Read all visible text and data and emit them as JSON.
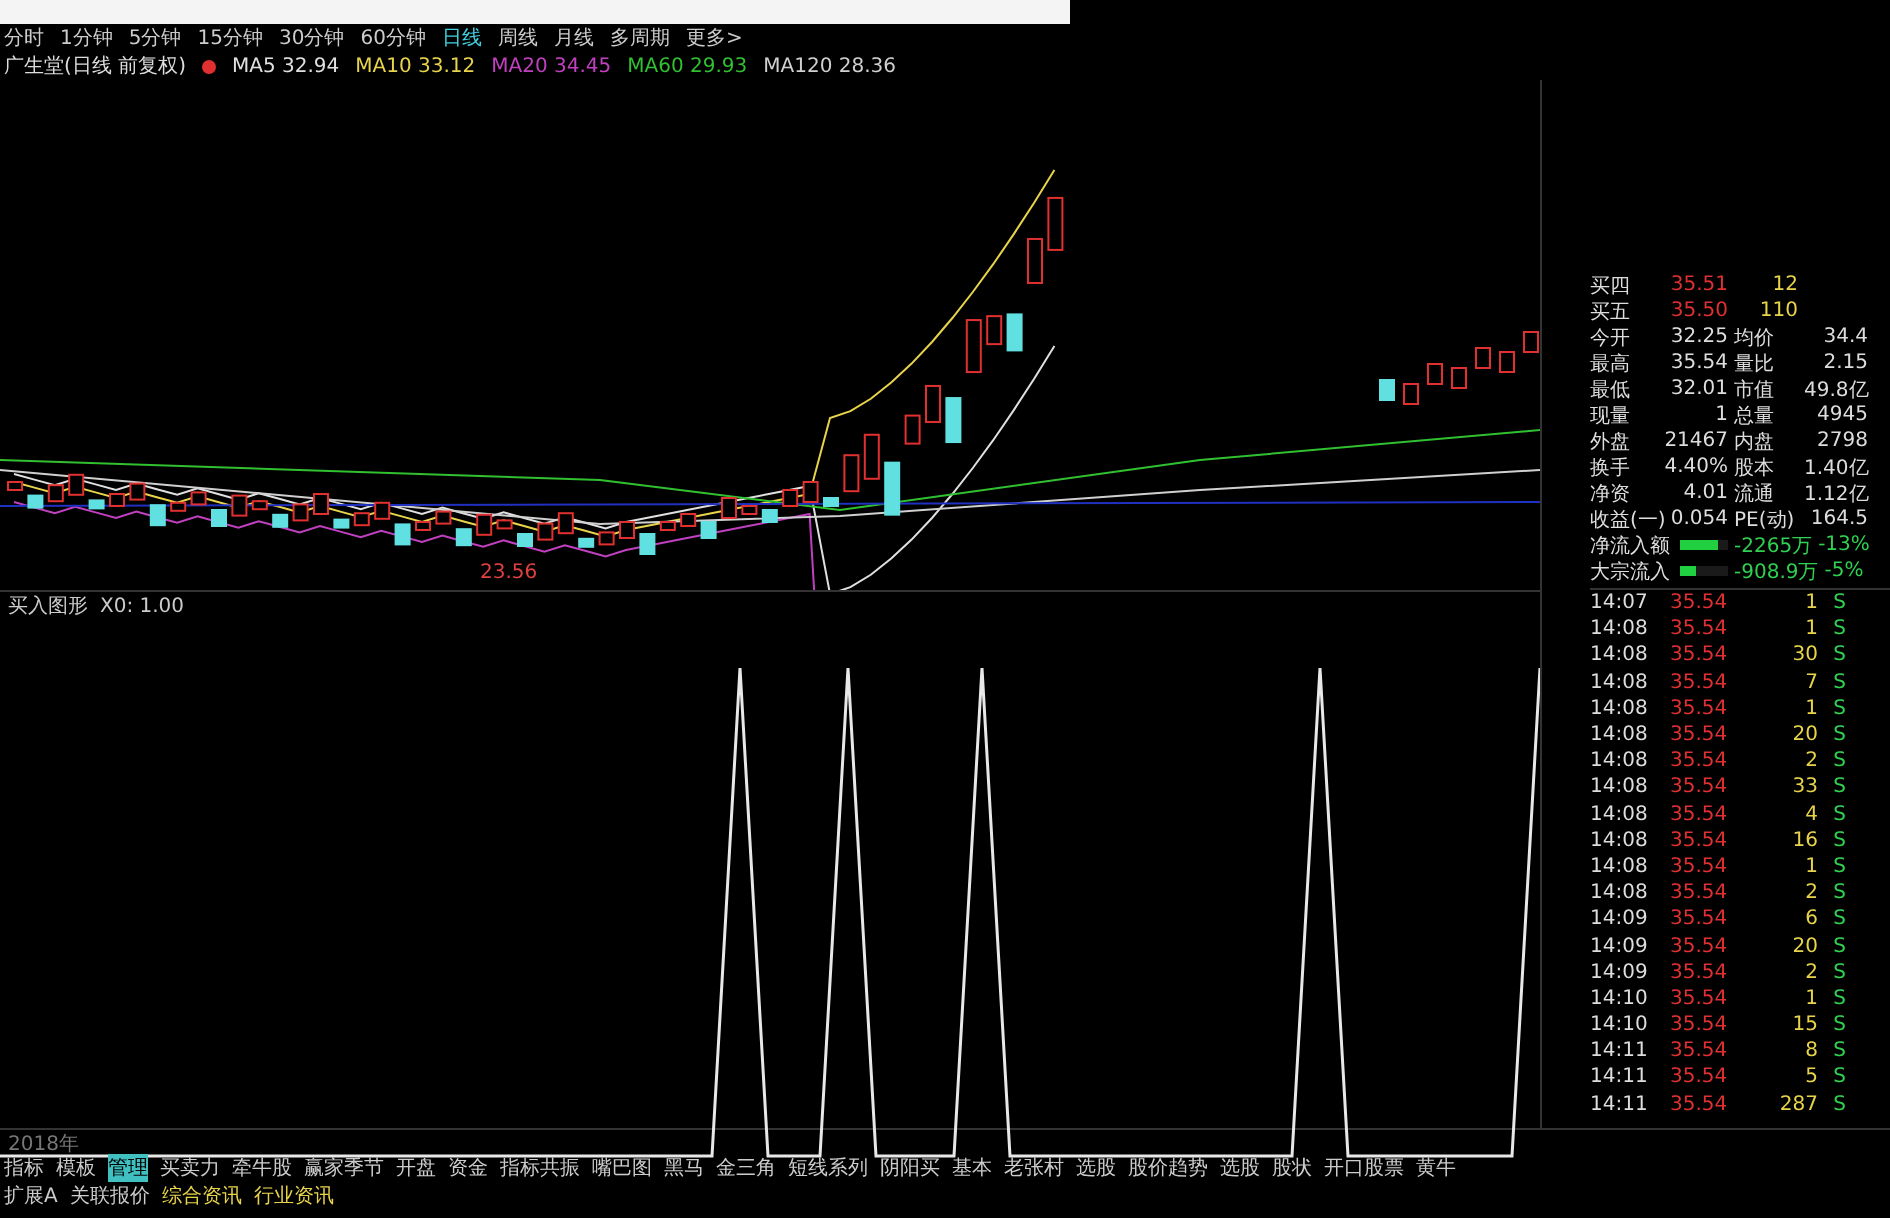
{
  "periods": [
    {
      "label": "分时",
      "selected": false
    },
    {
      "label": "1分钟",
      "selected": false
    },
    {
      "label": "5分钟",
      "selected": false
    },
    {
      "label": "15分钟",
      "selected": false
    },
    {
      "label": "30分钟",
      "selected": false
    },
    {
      "label": "60分钟",
      "selected": false
    },
    {
      "label": "日线",
      "selected": true
    },
    {
      "label": "周线",
      "selected": false
    },
    {
      "label": "月线",
      "selected": false
    },
    {
      "label": "多周期",
      "selected": false
    },
    {
      "label": "更多>",
      "selected": false
    }
  ],
  "legend": {
    "stock": "广生堂(日线 前复权)",
    "averages": [
      {
        "label": "MA5",
        "value": "32.94",
        "color": "#e0e0e0"
      },
      {
        "label": "MA10",
        "value": "33.12",
        "color": "#e8d44a"
      },
      {
        "label": "MA20",
        "value": "34.45",
        "color": "#c040c0"
      },
      {
        "label": "MA60",
        "value": "29.93",
        "color": "#30c030"
      },
      {
        "label": "MA120",
        "value": "28.36",
        "color": "#d0d0d0"
      }
    ]
  },
  "main_chart": {
    "low_label": "23.56"
  },
  "indicator": {
    "title": "买入图形",
    "param": "X0: 1.00"
  },
  "quote": {
    "orders": [
      {
        "label": "买四",
        "price": "35.51",
        "volume": "12"
      },
      {
        "label": "买五",
        "price": "35.50",
        "volume": "110"
      }
    ],
    "stats": [
      {
        "label": "今开",
        "value": "32.25",
        "label2": "均价",
        "value2": "34.4"
      },
      {
        "label": "最高",
        "value": "35.54",
        "label2": "量比",
        "value2": "2.15"
      },
      {
        "label": "最低",
        "value": "32.01",
        "label2": "市值",
        "value2": "49.8亿"
      },
      {
        "label": "现量",
        "value": "1",
        "label2": "总量",
        "value2": "4945"
      },
      {
        "label": "外盘",
        "value": "21467",
        "label2": "内盘",
        "value2": "2798"
      },
      {
        "label": "换手",
        "value": "4.40%",
        "label2": "股本",
        "value2": "1.40亿"
      },
      {
        "label": "净资",
        "value": "4.01",
        "label2": "流通",
        "value2": "1.12亿"
      },
      {
        "label": "收益(一)",
        "value": "0.054",
        "label2": "PE(动)",
        "value2": "164.5"
      }
    ],
    "flows": [
      {
        "label": "净流入额",
        "level": 0.8,
        "value": "-2265万",
        "pct": "-13%"
      },
      {
        "label": "大宗流入",
        "level": 0.35,
        "value": "-908.9万",
        "pct": "-5%"
      }
    ]
  },
  "ticks": [
    {
      "time": "14:07",
      "price": "35.54",
      "volume": "1",
      "side": "S"
    },
    {
      "time": "14:08",
      "price": "35.54",
      "volume": "1",
      "side": "S"
    },
    {
      "time": "14:08",
      "price": "35.54",
      "volume": "30",
      "side": "S"
    },
    {
      "time": "14:08",
      "price": "35.54",
      "volume": "7",
      "side": "S"
    },
    {
      "time": "14:08",
      "price": "35.54",
      "volume": "1",
      "side": "S"
    },
    {
      "time": "14:08",
      "price": "35.54",
      "volume": "20",
      "side": "S"
    },
    {
      "time": "14:08",
      "price": "35.54",
      "volume": "2",
      "side": "S"
    },
    {
      "time": "14:08",
      "price": "35.54",
      "volume": "33",
      "side": "S"
    },
    {
      "time": "14:08",
      "price": "35.54",
      "volume": "4",
      "side": "S"
    },
    {
      "time": "14:08",
      "price": "35.54",
      "volume": "16",
      "side": "S"
    },
    {
      "time": "14:08",
      "price": "35.54",
      "volume": "1",
      "side": "S"
    },
    {
      "time": "14:08",
      "price": "35.54",
      "volume": "2",
      "side": "S"
    },
    {
      "time": "14:09",
      "price": "35.54",
      "volume": "6",
      "side": "S"
    },
    {
      "time": "14:09",
      "price": "35.54",
      "volume": "20",
      "side": "S"
    },
    {
      "time": "14:09",
      "price": "35.54",
      "volume": "2",
      "side": "S"
    },
    {
      "time": "14:10",
      "price": "35.54",
      "volume": "1",
      "side": "S"
    },
    {
      "time": "14:10",
      "price": "35.54",
      "volume": "15",
      "side": "S"
    },
    {
      "time": "14:11",
      "price": "35.54",
      "volume": "8",
      "side": "S"
    },
    {
      "time": "14:11",
      "price": "35.54",
      "volume": "5",
      "side": "S"
    },
    {
      "time": "14:11",
      "price": "35.54",
      "volume": "287",
      "side": "S"
    }
  ],
  "axis_label": "2018年",
  "indicator_tabs": [
    {
      "label": "指标",
      "selected": false
    },
    {
      "label": "模板",
      "selected": false
    },
    {
      "label": "管理",
      "selected": true
    },
    {
      "label": "买卖力",
      "selected": false
    },
    {
      "label": "牵牛股",
      "selected": false
    },
    {
      "label": "赢家季节",
      "selected": false
    },
    {
      "label": "开盘",
      "selected": false
    },
    {
      "label": "资金",
      "selected": false
    },
    {
      "label": "指标共振",
      "selected": false
    },
    {
      "label": "嘴巴图",
      "selected": false
    },
    {
      "label": "黑马",
      "selected": false
    },
    {
      "label": "金三角",
      "selected": false
    },
    {
      "label": "短线系列",
      "selected": false
    },
    {
      "label": "阴阳买",
      "selected": false
    },
    {
      "label": "基本",
      "selected": false
    },
    {
      "label": "老张村",
      "selected": false
    },
    {
      "label": "选股",
      "selected": false
    },
    {
      "label": "股价趋势",
      "selected": false
    },
    {
      "label": "选股",
      "selected": false
    },
    {
      "label": "股状",
      "selected": false
    },
    {
      "label": "开口股票",
      "selected": false
    },
    {
      "label": "黄牛",
      "selected": false
    }
  ],
  "info_tabs": [
    {
      "label": "扩展A",
      "kind": "plain"
    },
    {
      "label": "关联报价",
      "kind": "plain"
    },
    {
      "label": "综合资讯",
      "kind": "news"
    },
    {
      "label": "行业资讯",
      "kind": "news"
    }
  ]
}
